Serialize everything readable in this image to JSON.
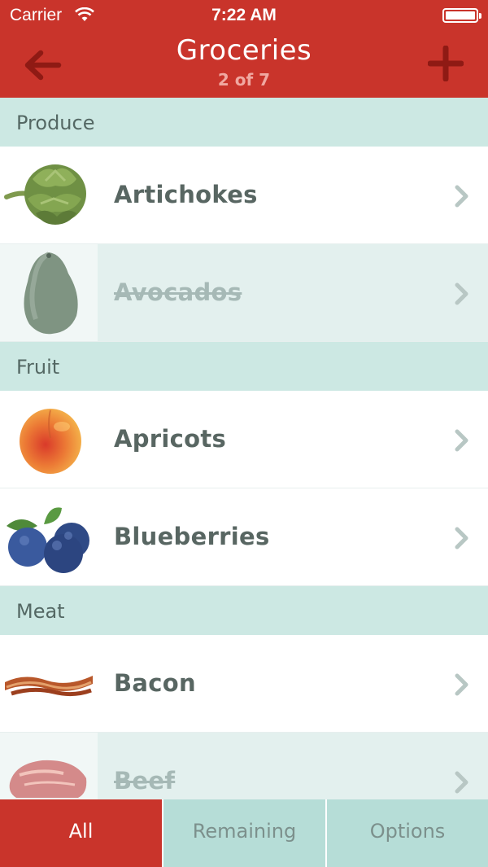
{
  "status_bar": {
    "carrier": "Carrier",
    "time": "7:22 AM"
  },
  "nav": {
    "title": "Groceries",
    "subtitle": "2 of 7",
    "back_icon": "arrow-left-icon",
    "add_icon": "plus-icon"
  },
  "sections": [
    {
      "title": "Produce",
      "items": [
        {
          "label": "Artichokes",
          "done": false,
          "icon": "artichoke"
        },
        {
          "label": "Avocados",
          "done": true,
          "icon": "avocado"
        }
      ]
    },
    {
      "title": "Fruit",
      "items": [
        {
          "label": "Apricots",
          "done": false,
          "icon": "apricot"
        },
        {
          "label": "Blueberries",
          "done": false,
          "icon": "blueberries"
        }
      ]
    },
    {
      "title": "Meat",
      "items": [
        {
          "label": "Bacon",
          "done": false,
          "icon": "bacon"
        },
        {
          "label": "Beef",
          "done": true,
          "icon": "beef"
        }
      ]
    }
  ],
  "tabs": [
    {
      "label": "All",
      "active": true
    },
    {
      "label": "Remaining",
      "active": false
    },
    {
      "label": "Options",
      "active": false
    }
  ],
  "colors": {
    "accent_red": "#c9342b",
    "section_bg": "#cce8e3",
    "done_row_bg": "#e3f0ee",
    "tab_inactive_bg": "#b6ddd7",
    "text_dark": "#586662"
  }
}
